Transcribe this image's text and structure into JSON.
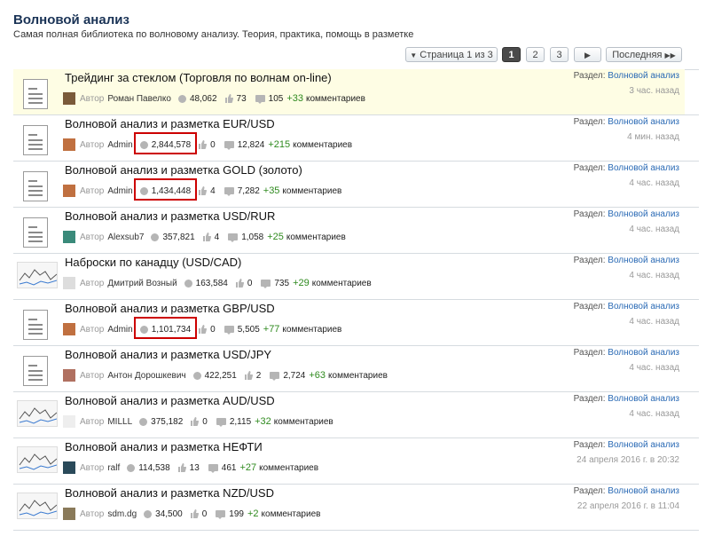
{
  "header": {
    "title": "Волновой анализ",
    "subtitle": "Самая полная библиотека по волновому анализу. Теория, практика, помощь в разметке"
  },
  "pagination": {
    "page_select": "Страница 1 из 3",
    "pages": [
      "1",
      "2",
      "3"
    ],
    "current": "1",
    "last": "Последняя"
  },
  "labels": {
    "author": "Автор",
    "section": "Раздел:",
    "comments": "комментариев"
  },
  "colors": {
    "link": "#2a6ab5",
    "plus": "#2f8a1f",
    "highlight_row": "#fefde4",
    "annotation_box": "#cc0000"
  },
  "topics": [
    {
      "title": "Трейдинг за стеклом (Торговля по волнам on-line)",
      "author": "Роман Павелко",
      "views": "48,062",
      "likes": "73",
      "comments": "105",
      "new_comments": "+33",
      "section": "Волновой анализ",
      "time": "3 час. назад",
      "icon": "document-icon",
      "highlighted": true,
      "boxed": false
    },
    {
      "title": "Волновой анализ и разметка EUR/USD",
      "author": "Admin",
      "views": "2,844,578",
      "likes": "0",
      "comments": "12,824",
      "new_comments": "+215",
      "section": "Волновой анализ",
      "time": "4 мин. назад",
      "icon": "document-icon",
      "highlighted": false,
      "boxed": true
    },
    {
      "title": "Волновой анализ и разметка GOLD (золото)",
      "author": "Admin",
      "views": "1,434,448",
      "likes": "4",
      "comments": "7,282",
      "new_comments": "+35",
      "section": "Волновой анализ",
      "time": "4 час. назад",
      "icon": "document-icon",
      "highlighted": false,
      "boxed": true
    },
    {
      "title": "Волновой анализ и разметка USD/RUR",
      "author": "Alexsub7",
      "views": "357,821",
      "likes": "4",
      "comments": "1,058",
      "new_comments": "+25",
      "section": "Волновой анализ",
      "time": "4 час. назад",
      "icon": "document-icon",
      "highlighted": false,
      "boxed": false
    },
    {
      "title": "Наброски по канадцу (USD/CAD)",
      "author": "Дмитрий Возный",
      "views": "163,584",
      "likes": "0",
      "comments": "735",
      "new_comments": "+29",
      "section": "Волновой анализ",
      "time": "4 час. назад",
      "icon": "chart-thumbnail",
      "highlighted": false,
      "boxed": false
    },
    {
      "title": "Волновой анализ и разметка GBP/USD",
      "author": "Admin",
      "views": "1,101,734",
      "likes": "0",
      "comments": "5,505",
      "new_comments": "+77",
      "section": "Волновой анализ",
      "time": "4 час. назад",
      "icon": "document-icon",
      "highlighted": false,
      "boxed": true
    },
    {
      "title": "Волновой анализ и разметка USD/JPY",
      "author": "Антон Дорошкевич",
      "views": "422,251",
      "likes": "2",
      "comments": "2,724",
      "new_comments": "+63",
      "section": "Волновой анализ",
      "time": "4 час. назад",
      "icon": "document-icon",
      "highlighted": false,
      "boxed": false
    },
    {
      "title": "Волновой анализ и разметка AUD/USD",
      "author": "MILLL",
      "views": "375,182",
      "likes": "0",
      "comments": "2,115",
      "new_comments": "+32",
      "section": "Волновой анализ",
      "time": "4 час. назад",
      "icon": "chart-thumbnail",
      "highlighted": false,
      "boxed": false
    },
    {
      "title": "Волновой анализ и разметка НЕФТИ",
      "author": "ralf",
      "views": "114,538",
      "likes": "13",
      "comments": "461",
      "new_comments": "+27",
      "section": "Волновой анализ",
      "time": "24 апреля 2016 г. в 20:32",
      "icon": "chart-thumbnail",
      "highlighted": false,
      "boxed": false
    },
    {
      "title": "Волновой анализ и разметка NZD/USD",
      "author": "sdm.dg",
      "views": "34,500",
      "likes": "0",
      "comments": "199",
      "new_comments": "+2",
      "section": "Волновой анализ",
      "time": "22 апреля 2016 г. в 11:04",
      "icon": "chart-thumbnail",
      "highlighted": false,
      "boxed": false
    }
  ]
}
